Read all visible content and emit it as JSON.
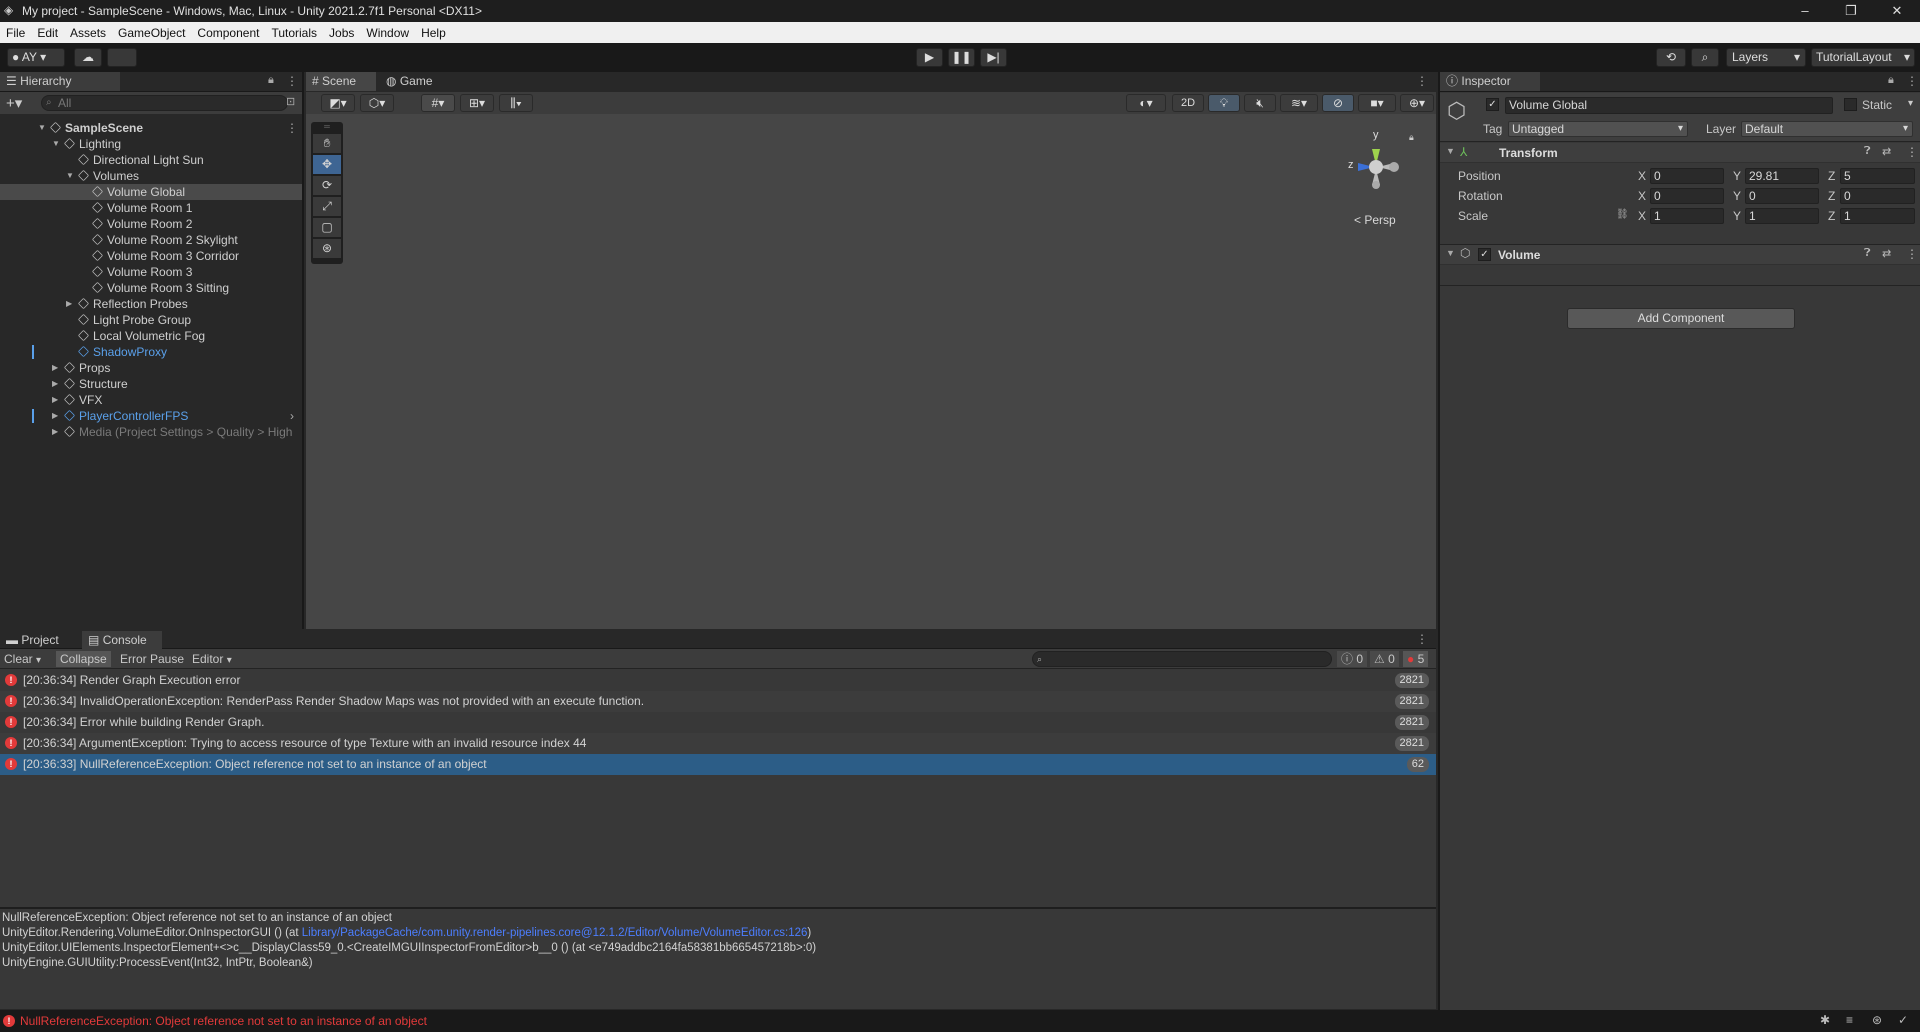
{
  "window": {
    "title": "My project - SampleScene - Windows, Mac, Linux - Unity 2021.2.7f1 Personal <DX11>",
    "min": "–",
    "max": "❐",
    "close": "✕"
  },
  "menu": [
    "File",
    "Edit",
    "Assets",
    "GameObject",
    "Component",
    "Tutorials",
    "Jobs",
    "Window",
    "Help"
  ],
  "toolbar": {
    "account": "AY",
    "layers": "Layers",
    "layout": "TutorialLayout"
  },
  "hierarchy": {
    "tab": "Hierarchy",
    "search_placeholder": "All",
    "items": [
      {
        "label": "SampleScene",
        "depth": 0,
        "bold": true
      },
      {
        "label": "Lighting",
        "depth": 1
      },
      {
        "label": "Directional Light Sun",
        "depth": 2
      },
      {
        "label": "Volumes",
        "depth": 2
      },
      {
        "label": "Volume Global",
        "depth": 3,
        "selected": true
      },
      {
        "label": "Volume Room 1",
        "depth": 3
      },
      {
        "label": "Volume Room 2",
        "depth": 3
      },
      {
        "label": "Volume Room 2 Skylight",
        "depth": 3
      },
      {
        "label": "Volume Room 3 Corridor",
        "depth": 3
      },
      {
        "label": "Volume Room 3",
        "depth": 3
      },
      {
        "label": "Volume Room 3 Sitting",
        "depth": 3
      },
      {
        "label": "Reflection Probes",
        "depth": 2
      },
      {
        "label": "Light Probe Group",
        "depth": 2
      },
      {
        "label": "Local Volumetric Fog",
        "depth": 2
      },
      {
        "label": "ShadowProxy",
        "depth": 2,
        "prefab": true
      },
      {
        "label": "Props",
        "depth": 1
      },
      {
        "label": "Structure",
        "depth": 1
      },
      {
        "label": "VFX",
        "depth": 1
      },
      {
        "label": "PlayerControllerFPS",
        "depth": 1,
        "prefab": true
      },
      {
        "label": "Media (Project Settings > Quality > High",
        "depth": 1,
        "dim": true
      }
    ]
  },
  "scene": {
    "tab_scene": "Scene",
    "tab_game": "Game",
    "btn_2d": "2D",
    "persp": "< Persp",
    "gizmo_y": "y",
    "gizmo_z": "z"
  },
  "inspector": {
    "tab": "Inspector",
    "name": "Volume Global",
    "static": "Static",
    "tag_label": "Tag",
    "tag_value": "Untagged",
    "layer_label": "Layer",
    "layer_value": "Default",
    "transform": "Transform",
    "position_label": "Position",
    "rotation_label": "Rotation",
    "scale_label": "Scale",
    "position": [
      "0",
      "29.81",
      "5"
    ],
    "rotation": [
      "0",
      "0",
      "0"
    ],
    "scale": [
      "1",
      "1",
      "1"
    ],
    "axis": [
      "X",
      "Y",
      "Z"
    ],
    "volume": "Volume",
    "add_component": "Add Component"
  },
  "bottom": {
    "tab_project": "Project",
    "tab_console": "Console",
    "clear": "Clear",
    "collapse": "Collapse",
    "error_pause": "Error Pause",
    "editor": "Editor",
    "count_info": "0",
    "count_warn": "0",
    "count_err": "5",
    "rows": [
      {
        "text": "[20:36:34] Render Graph Execution error",
        "count": "2821"
      },
      {
        "text": "[20:36:34] InvalidOperationException: RenderPass Render Shadow Maps was not provided with an execute function.",
        "count": "2821"
      },
      {
        "text": "[20:36:34] Error while building Render Graph.",
        "count": "2821"
      },
      {
        "text": "[20:36:34] ArgumentException: Trying to access resource of type Texture with an invalid resource index 44",
        "count": "2821"
      },
      {
        "text": "[20:36:33] NullReferenceException: Object reference not set to an instance of an object",
        "count": "62",
        "selected": true
      }
    ],
    "detail": [
      "NullReferenceException: Object reference not set to an instance of an object",
      "UnityEditor.Rendering.VolumeEditor.OnInspectorGUI () (at ",
      "Library/PackageCache/com.unity.render-pipelines.core@12.1.2/Editor/Volume/VolumeEditor.cs:126",
      ")",
      "UnityEditor.UIElements.InspectorElement+<>c__DisplayClass59_0.<CreateIMGUIInspectorFromEditor>b__0 () (at <e749addbc2164fa58381bb665457218b>:0)",
      "UnityEngine.GUIUtility:ProcessEvent(Int32, IntPtr, Boolean&)"
    ],
    "status": "NullReferenceException: Object reference not set to an instance of an object"
  },
  "colors": {
    "accent": "#2c5d87",
    "prefab": "#5aa0ea",
    "error": "#e23a3a"
  }
}
